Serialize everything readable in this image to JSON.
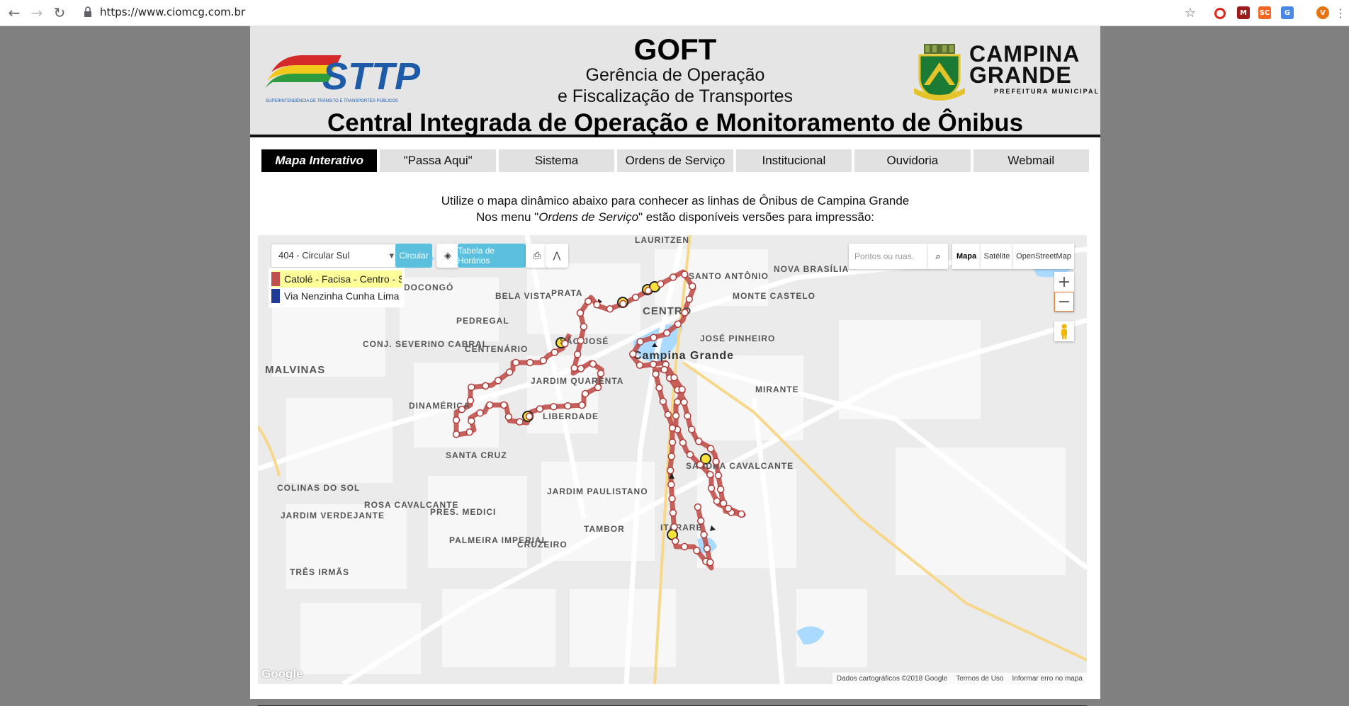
{
  "browser": {
    "url": "https://www.ciomcg.com.br",
    "back_icon": "arrow-left-icon",
    "forward_icon": "arrow-right-icon",
    "reload_icon": "reload-icon",
    "bookmark_icon": "star-icon",
    "profile_initial": "V"
  },
  "header": {
    "sttp_logo_text": "STTP",
    "sttp_logo_subtitle": "SUPERINTENDÊNCIA DE TRÂNSITO E TRANSPORTES PÚBLICOS",
    "title": "GOFT",
    "subtitle_line1": "Gerência de Operação",
    "subtitle_line2": "e Fiscalização de Transportes",
    "city_logo_line1": "CAMPINA",
    "city_logo_line2": "GRANDE",
    "city_logo_line3": "PREFEITURA MUNICIPAL",
    "main_title": "Central Integrada de Operação e Monitoramento de Ônibus"
  },
  "menu": [
    {
      "label": "Mapa Interativo",
      "active": true
    },
    {
      "label": "\"Passa Aqui\"",
      "active": false
    },
    {
      "label": "Sistema",
      "active": false
    },
    {
      "label": "Ordens de Serviço",
      "active": false
    },
    {
      "label": "Institucional",
      "active": false
    },
    {
      "label": "Ouvidoria",
      "active": false
    },
    {
      "label": "Webmail",
      "active": false
    }
  ],
  "intro": {
    "line1": "Utilize o mapa dinâmico abaixo para conhecer as linhas de Ônibus de Campina Grande",
    "line2_before": "Nos menu \"",
    "line2_em": "Ordens de Serviço",
    "line2_after": "\" estão disponíveis versões para impressão:"
  },
  "map": {
    "line_select_value": "404 - Circular Sul",
    "btn_circular": "Circular",
    "btn_timetable": "Tabela de Horários",
    "legend": [
      {
        "label": "Catolé - Facisa - Centro - São José",
        "color": "#c0504d",
        "bg": "#ffff99"
      },
      {
        "label": "Via Nenzinha Cunha Lima - Açude Velho",
        "color": "#1f3a93",
        "bg": "#ffffff"
      }
    ],
    "search_placeholder": "Pontos ou ruas.",
    "map_types": [
      "Mapa",
      "Satélite",
      "OpenStreetMap"
    ],
    "zoom_in": "+",
    "zoom_out": "−",
    "footer": [
      "Dados cartográficos ©2018 Google",
      "Termos de Uso",
      "Informar erro no mapa"
    ],
    "google_watermark": "Google",
    "route_color": "#c0504d",
    "labels": [
      "LAURITZEN",
      "SANTO ANTÔNIO",
      "NOVA BRASÍLIA",
      "BELA VISTA",
      "PRATA",
      "CENTRO",
      "MONTE CASTELO",
      "PEDREGAL",
      "CONJ. SEVERINO CABRAL",
      "CENTENÁRIO",
      "SÃO JOSÉ",
      "JOSÉ PINHEIRO",
      "Campina Grande",
      "MALVINAS",
      "JARDIM QUARENTA",
      "MIRANTE",
      "DINAMÉRICA",
      "LIBERDADE",
      "SANTA CRUZ",
      "SANDRA CAVALCANTE",
      "COLINAS DO SOL",
      "JARDIM PAULISTANO",
      "ROSA CAVALCANTE",
      "PRES. MEDICI",
      "JARDIM VERDEJANTE",
      "TAMBOR",
      "ITARARÉ",
      "PALMEIRA IMPERIAL",
      "CRUZEIRO",
      "TRÊS IRMÃS",
      "BODOCONGÓ"
    ]
  }
}
